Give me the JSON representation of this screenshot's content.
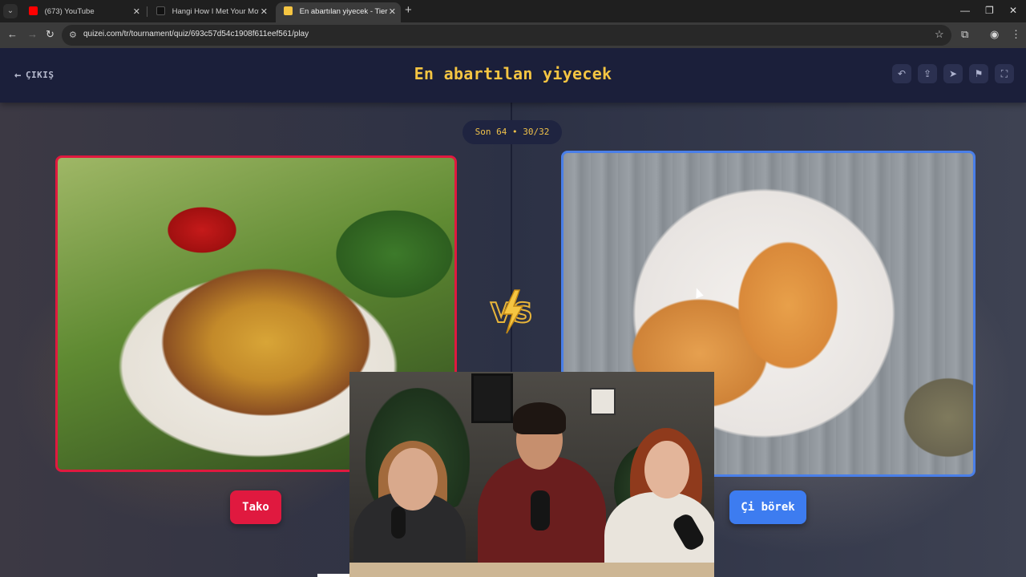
{
  "browser": {
    "tabs": [
      {
        "label": "(673) YouTube",
        "favicon": "youtube-icon",
        "color": "#ff0000"
      },
      {
        "label": "Hangi How I Met Your Mother",
        "favicon": "quizei-dark-icon",
        "color": "#111111"
      },
      {
        "label": "En abartılan yiyecek - Tier List,",
        "favicon": "quizei-icon",
        "color": "#f5c542",
        "active": true
      }
    ],
    "url": "quizei.com/tr/tournament/quiz/693c57d54c1908f611eef561/play"
  },
  "header": {
    "exit_label": "ÇIKIŞ",
    "title": "En abartılan yiyecek",
    "actions": [
      "undo-icon",
      "share-icon",
      "send-icon",
      "flag-icon",
      "fullscreen-icon"
    ]
  },
  "round": {
    "progress_label": "Son 64 • 30/32"
  },
  "match": {
    "left": {
      "name": "Tako",
      "image": "taco-plate",
      "accent": "#e0193f"
    },
    "right": {
      "name": "Çi börek",
      "image": "chibureki-plate",
      "accent": "#3d7cf0"
    },
    "vs_label": "VS"
  },
  "colors": {
    "title": "#f5c542",
    "topbar": "#1b1f3a"
  }
}
